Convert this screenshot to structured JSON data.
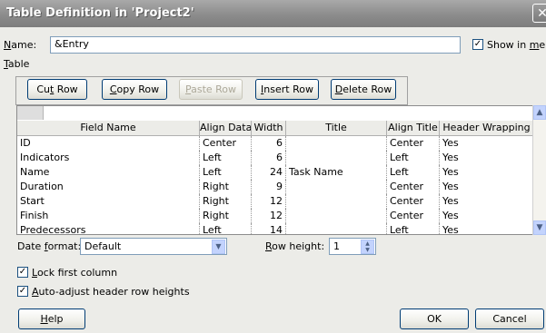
{
  "window": {
    "title": "Table Definition in 'Project2'"
  },
  "name_field": {
    "label_u": "N",
    "label_rest": "ame:",
    "value": "&Entry"
  },
  "show_in_menu": {
    "label_pre": "Show in ",
    "label_u": "m",
    "label_rest": "enu",
    "checked": true
  },
  "table_label": {
    "u": "T",
    "rest": "able"
  },
  "toolbar": {
    "cut_u": "t",
    "cut_pre": "Cu",
    "cut_post": " Row",
    "copy_u": "C",
    "copy_rest": "opy Row",
    "paste_u": "P",
    "paste_rest": "aste Row",
    "insert_u": "I",
    "insert_rest": "nsert Row",
    "delete_u": "D",
    "delete_rest": "elete Row"
  },
  "grid": {
    "headers": [
      "Field Name",
      "Align Data",
      "Width",
      "Title",
      "Align Title",
      "Header Wrapping"
    ],
    "rows": [
      [
        "ID",
        "Center",
        "6",
        "",
        "Center",
        "Yes"
      ],
      [
        "Indicators",
        "Left",
        "6",
        "",
        "Left",
        "Yes"
      ],
      [
        "Name",
        "Left",
        "24",
        "Task Name",
        "Left",
        "Yes"
      ],
      [
        "Duration",
        "Right",
        "9",
        "",
        "Center",
        "Yes"
      ],
      [
        "Start",
        "Right",
        "12",
        "",
        "Center",
        "Yes"
      ],
      [
        "Finish",
        "Right",
        "12",
        "",
        "Center",
        "Yes"
      ],
      [
        "Predecessors",
        "Left",
        "14",
        "",
        "Left",
        "Yes"
      ]
    ]
  },
  "date_format": {
    "label_pre": "Date ",
    "label_u": "f",
    "label_rest": "ormat:",
    "value": "Default"
  },
  "row_height": {
    "label_u": "R",
    "label_rest": "ow height:",
    "value": "1"
  },
  "lock_first_column": {
    "label_u": "L",
    "label_rest": "ock first column",
    "checked": true
  },
  "auto_adjust": {
    "label_u": "A",
    "label_rest": "uto-adjust header row heights",
    "checked": true
  },
  "buttons": {
    "help_u": "H",
    "help_rest": "elp",
    "ok": "OK",
    "cancel": "Cancel"
  }
}
